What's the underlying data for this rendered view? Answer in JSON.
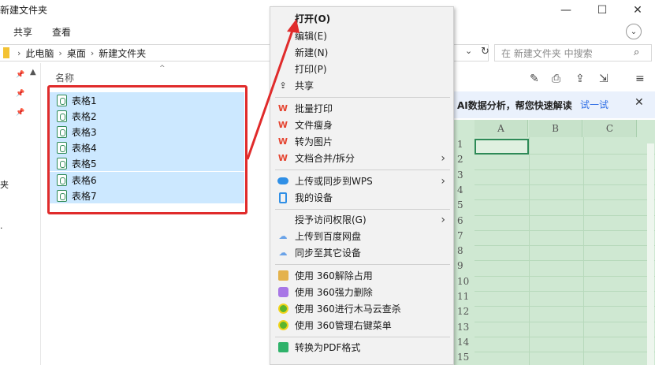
{
  "window": {
    "title": "新建文件夹",
    "minimize": "—",
    "maximize": "☐",
    "close": "✕"
  },
  "ribbon": {
    "tabs": [
      "共享",
      "查看"
    ]
  },
  "address": {
    "crumbs": [
      "此电脑",
      "桌面",
      "新建文件夹"
    ],
    "search_placeholder": "在 新建文件夹 中搜索"
  },
  "nav": {
    "partial_text": "夹",
    "partial_dot": "·"
  },
  "list": {
    "column_name": "名称",
    "files": [
      "表格1",
      "表格2",
      "表格3",
      "表格4",
      "表格5",
      "表格6",
      "表格7"
    ]
  },
  "preview": {
    "ai_banner": "AI数据分析，帮您快速解读",
    "ai_button": "试一试",
    "columns": [
      "A",
      "B",
      "C"
    ],
    "rows": [
      "1",
      "2",
      "3",
      "4",
      "5",
      "6",
      "7",
      "8",
      "9",
      "10",
      "11",
      "12",
      "13",
      "14",
      "15"
    ]
  },
  "context_menu": {
    "items": [
      {
        "label": "打开(O)",
        "bold": true
      },
      {
        "label": "编辑(E)"
      },
      {
        "label": "新建(N)"
      },
      {
        "label": "打印(P)"
      },
      {
        "label": "共享",
        "icon": "share-icon"
      },
      {
        "label": "批量打印",
        "icon": "wps-icon"
      },
      {
        "label": "文件瘦身",
        "icon": "wps-icon"
      },
      {
        "label": "转为图片",
        "icon": "wps-icon"
      },
      {
        "label": "文档合并/拆分",
        "icon": "wps-icon",
        "submenu": true
      },
      {
        "label": "上传或同步到WPS",
        "icon": "cloud-icon",
        "submenu": true
      },
      {
        "label": "我的设备",
        "icon": "device-icon"
      },
      {
        "label": "授予访问权限(G)",
        "submenu": true
      },
      {
        "label": "上传到百度网盘",
        "icon": "baidu-icon"
      },
      {
        "label": "同步至其它设备",
        "icon": "baidu-icon"
      },
      {
        "label": "使用 360解除占用",
        "icon": "360-unlock-icon"
      },
      {
        "label": "使用 360强力删除",
        "icon": "360-delete-icon"
      },
      {
        "label": "使用 360进行木马云查杀",
        "icon": "360-scan-icon"
      },
      {
        "label": "使用 360管理右键菜单",
        "icon": "360-scan-icon"
      },
      {
        "label": "转换为PDF格式",
        "icon": "pdf-icon"
      }
    ]
  }
}
